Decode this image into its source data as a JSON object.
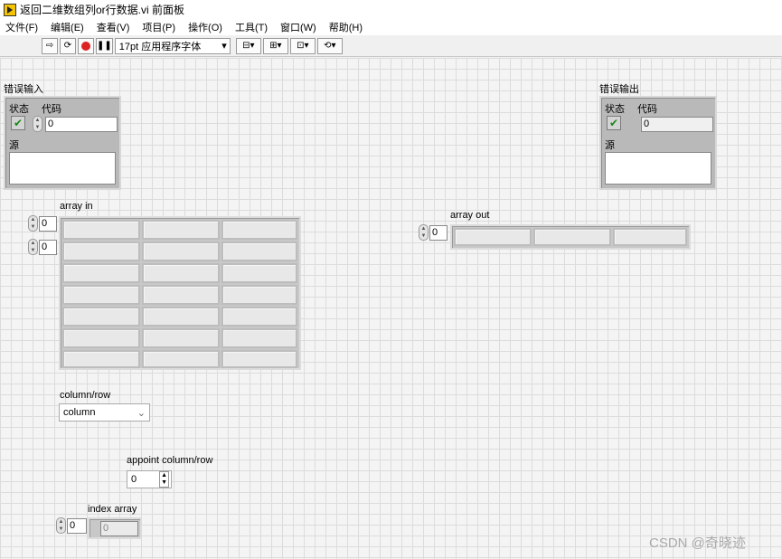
{
  "window": {
    "title": "返回二维数组列or行数据.vi 前面板"
  },
  "menu": [
    "文件(F)",
    "编辑(E)",
    "查看(V)",
    "项目(P)",
    "操作(O)",
    "工具(T)",
    "窗口(W)",
    "帮助(H)"
  ],
  "toolbar": {
    "font": "17pt 应用程序字体"
  },
  "error_in": {
    "title": "错误输入",
    "status_label": "状态",
    "code_label": "代码",
    "code_value": "0",
    "source_label": "源"
  },
  "error_out": {
    "title": "错误输出",
    "status_label": "状态",
    "code_label": "代码",
    "code_value": "0",
    "source_label": "源"
  },
  "array_in": {
    "label": "array in",
    "row_index": "0",
    "col_index": "0"
  },
  "array_out": {
    "label": "array out",
    "index": "0"
  },
  "column_row": {
    "label": "column/row",
    "value": "column"
  },
  "appoint": {
    "label": "appoint column/row",
    "value": "0"
  },
  "index_array": {
    "label": "index array",
    "index": "0",
    "value": "0"
  },
  "watermark": "CSDN @奇晓迹"
}
